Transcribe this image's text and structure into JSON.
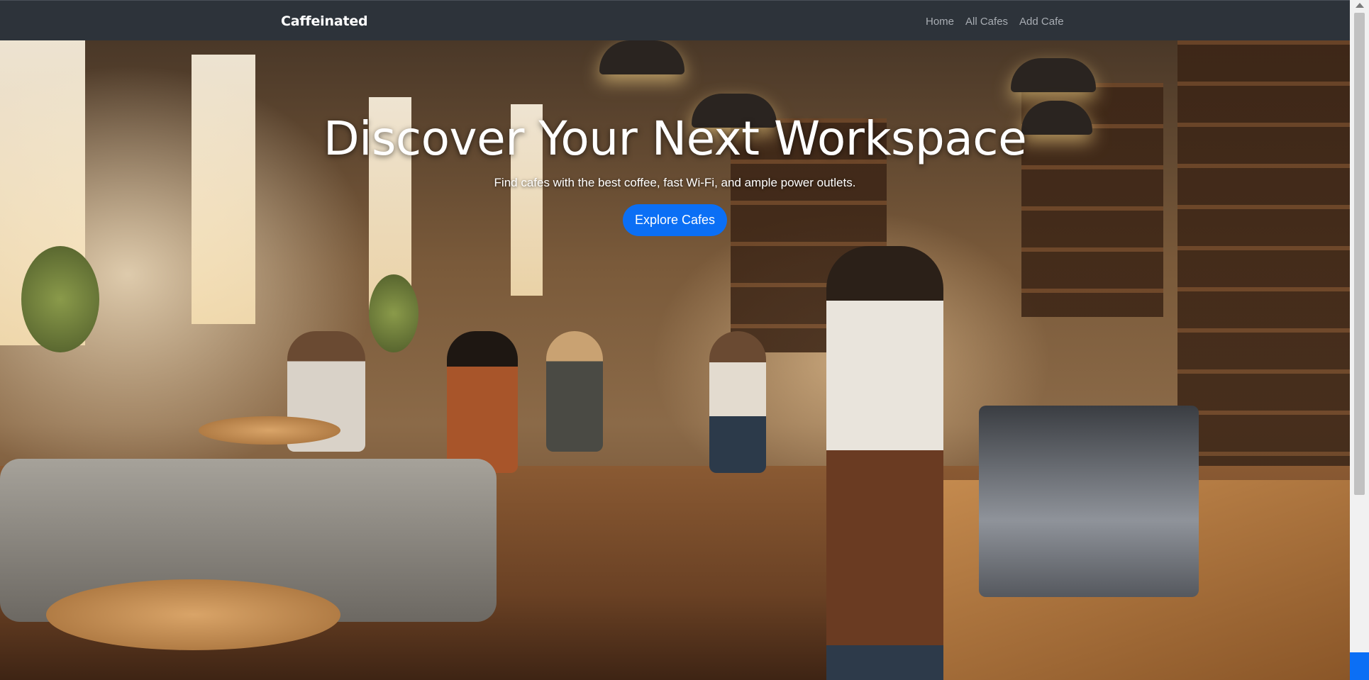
{
  "navbar": {
    "brand": "Caffeinated",
    "links": [
      {
        "label": "Home"
      },
      {
        "label": "All Cafes"
      },
      {
        "label": "Add Cafe"
      }
    ]
  },
  "hero": {
    "title": "Discover Your Next Workspace",
    "subtitle": "Find cafes with the best coffee, fast Wi-Fi, and ample power outlets.",
    "cta_label": "Explore Cafes",
    "background_image": "cafe-interior-photo"
  },
  "colors": {
    "navbar_bg": "#2d333a",
    "accent": "#0b6ff5",
    "nav_link": "#a8adb3"
  }
}
